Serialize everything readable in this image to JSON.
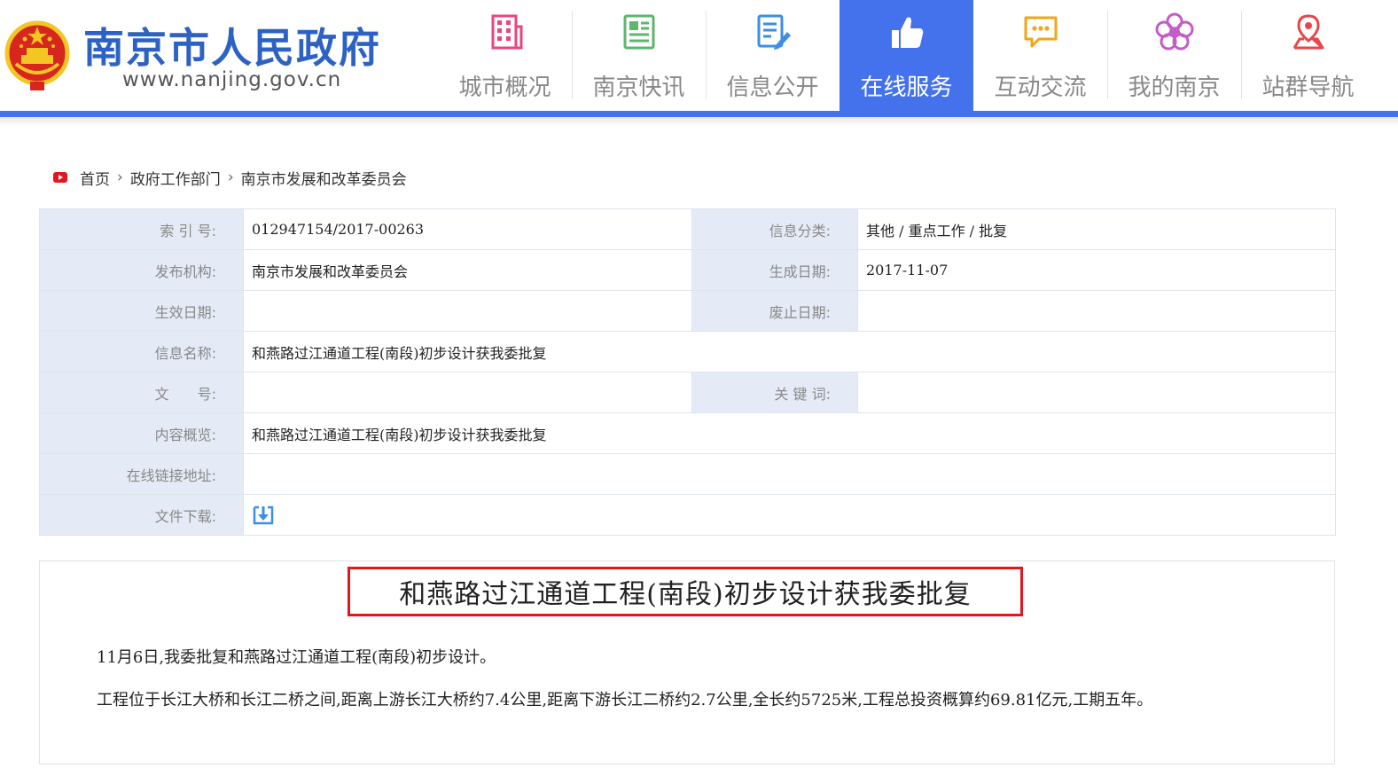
{
  "site": {
    "title": "南京市人民政府",
    "url": "www.nanjing.gov.cn"
  },
  "nav": {
    "items": [
      {
        "label": "城市概况",
        "icon": "building-icon",
        "color": "#e8467c"
      },
      {
        "label": "南京快讯",
        "icon": "newspaper-icon",
        "color": "#5fb56b"
      },
      {
        "label": "信息公开",
        "icon": "document-edit-icon",
        "color": "#3c8ee6"
      },
      {
        "label": "在线服务",
        "icon": "thumbs-up-icon",
        "color": "#ffffff",
        "active": true
      },
      {
        "label": "互动交流",
        "icon": "chat-bubble-icon",
        "color": "#f2a516"
      },
      {
        "label": "我的南京",
        "icon": "plum-blossom-icon",
        "color": "#c45bc9"
      },
      {
        "label": "站群导航",
        "icon": "location-pin-icon",
        "color": "#e8464a"
      }
    ]
  },
  "breadcrumb": {
    "home": "首页",
    "level2": "政府工作部门",
    "level3": "南京市发展和改革委员会"
  },
  "info": {
    "index_label": "索 引 号:",
    "index_value": "012947154/2017-00263",
    "category_label": "信息分类:",
    "category_value": "其他 / 重点工作 / 批复",
    "publisher_label": "发布机构:",
    "publisher_value": "南京市发展和改革委员会",
    "created_label": "生成日期:",
    "created_value": "2017-11-07",
    "effective_label": "生效日期:",
    "effective_value": "",
    "abolished_label": "废止日期:",
    "abolished_value": "",
    "name_label": "信息名称:",
    "name_value": "和燕路过江通道工程(南段)初步设计获我委批复",
    "docno_label": "文　　号:",
    "docno_value": "",
    "keywords_label": "关 键 词:",
    "keywords_value": "",
    "summary_label": "内容概览:",
    "summary_value": "和燕路过江通道工程(南段)初步设计获我委批复",
    "link_label": "在线链接地址:",
    "link_value": "",
    "download_label": "文件下载:"
  },
  "article": {
    "title": "和燕路过江通道工程(南段)初步设计获我委批复",
    "para1": "11月6日,我委批复和燕路过江通道工程(南段)初步设计。",
    "para2": "工程位于长江大桥和长江二桥之间,距离上游长江大桥约7.4公里,距离下游长江二桥约2.7公里,全长约5725米,工程总投资概算约69.81亿元,工期五年。"
  },
  "colors": {
    "brand_blue": "#2d62c4",
    "nav_active": "#4472ec",
    "label_bg": "#e5ebf6",
    "highlight_red": "#e3161d"
  }
}
